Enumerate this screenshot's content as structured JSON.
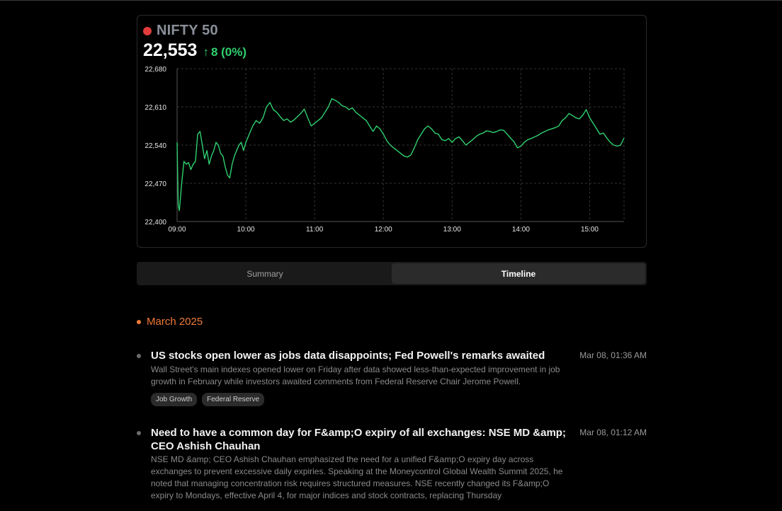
{
  "header": {
    "index_name": "NIFTY 50",
    "price": "22,553",
    "change_arrow": "↑",
    "change": "8 (0%)",
    "colors": {
      "live_dot": "#e23b3b",
      "up": "#2fd06f",
      "line": "#2fd06f"
    }
  },
  "chart_data": {
    "type": "line",
    "title": "",
    "xlabel": "",
    "ylabel": "",
    "y_ticks": [
      "22,400",
      "22,470",
      "22,540",
      "22,610",
      "22,680"
    ],
    "y_tick_values": [
      22400,
      22470,
      22540,
      22610,
      22680
    ],
    "x_ticks": [
      "09:00",
      "10:00",
      "11:00",
      "12:00",
      "13:00",
      "14:00",
      "15:00"
    ],
    "ylim": [
      22400,
      22680
    ],
    "xlim": [
      "09:00",
      "15:30"
    ],
    "grid": true,
    "series": [
      {
        "values": [
          [
            "09:00",
            22545
          ],
          [
            "09:01",
            22430
          ],
          [
            "09:02",
            22420
          ],
          [
            "09:04",
            22470
          ],
          [
            "09:06",
            22510
          ],
          [
            "09:08",
            22505
          ],
          [
            "09:10",
            22508
          ],
          [
            "09:12",
            22495
          ],
          [
            "09:14",
            22505
          ],
          [
            "09:16",
            22510
          ],
          [
            "09:18",
            22560
          ],
          [
            "09:20",
            22565
          ],
          [
            "09:22",
            22540
          ],
          [
            "09:24",
            22515
          ],
          [
            "09:26",
            22530
          ],
          [
            "09:28",
            22505
          ],
          [
            "09:30",
            22520
          ],
          [
            "09:32",
            22530
          ],
          [
            "09:34",
            22545
          ],
          [
            "09:36",
            22540
          ],
          [
            "09:38",
            22525
          ],
          [
            "09:40",
            22520
          ],
          [
            "09:42",
            22500
          ],
          [
            "09:44",
            22485
          ],
          [
            "09:46",
            22480
          ],
          [
            "09:48",
            22505
          ],
          [
            "09:50",
            22520
          ],
          [
            "09:52",
            22530
          ],
          [
            "09:54",
            22540
          ],
          [
            "09:56",
            22545
          ],
          [
            "09:58",
            22530
          ],
          [
            "10:00",
            22545
          ],
          [
            "10:03",
            22560
          ],
          [
            "10:06",
            22575
          ],
          [
            "10:09",
            22585
          ],
          [
            "10:12",
            22580
          ],
          [
            "10:15",
            22590
          ],
          [
            "10:18",
            22610
          ],
          [
            "10:21",
            22618
          ],
          [
            "10:24",
            22605
          ],
          [
            "10:27",
            22600
          ],
          [
            "10:30",
            22592
          ],
          [
            "10:33",
            22585
          ],
          [
            "10:36",
            22588
          ],
          [
            "10:39",
            22582
          ],
          [
            "10:42",
            22586
          ],
          [
            "10:45",
            22592
          ],
          [
            "10:48",
            22598
          ],
          [
            "10:51",
            22606
          ],
          [
            "10:54",
            22590
          ],
          [
            "10:57",
            22575
          ],
          [
            "11:00",
            22580
          ],
          [
            "11:03",
            22585
          ],
          [
            "11:06",
            22590
          ],
          [
            "11:09",
            22600
          ],
          [
            "11:12",
            22610
          ],
          [
            "11:15",
            22625
          ],
          [
            "11:18",
            22622
          ],
          [
            "11:21",
            22618
          ],
          [
            "11:24",
            22612
          ],
          [
            "11:27",
            22610
          ],
          [
            "11:30",
            22605
          ],
          [
            "11:33",
            22608
          ],
          [
            "11:36",
            22600
          ],
          [
            "11:39",
            22595
          ],
          [
            "11:42",
            22590
          ],
          [
            "11:45",
            22585
          ],
          [
            "11:48",
            22575
          ],
          [
            "11:51",
            22565
          ],
          [
            "11:54",
            22575
          ],
          [
            "11:57",
            22570
          ],
          [
            "12:00",
            22560
          ],
          [
            "12:03",
            22548
          ],
          [
            "12:06",
            22540
          ],
          [
            "12:09",
            22535
          ],
          [
            "12:12",
            22530
          ],
          [
            "12:15",
            22525
          ],
          [
            "12:18",
            22520
          ],
          [
            "12:21",
            22518
          ],
          [
            "12:24",
            22522
          ],
          [
            "12:27",
            22535
          ],
          [
            "12:30",
            22550
          ],
          [
            "12:33",
            22560
          ],
          [
            "12:36",
            22570
          ],
          [
            "12:39",
            22575
          ],
          [
            "12:42",
            22570
          ],
          [
            "12:45",
            22562
          ],
          [
            "12:48",
            22560
          ],
          [
            "12:51",
            22550
          ],
          [
            "12:54",
            22548
          ],
          [
            "12:57",
            22552
          ],
          [
            "13:00",
            22545
          ],
          [
            "13:03",
            22552
          ],
          [
            "13:06",
            22555
          ],
          [
            "13:09",
            22548
          ],
          [
            "13:12",
            22540
          ],
          [
            "13:15",
            22545
          ],
          [
            "13:18",
            22550
          ],
          [
            "13:21",
            22556
          ],
          [
            "13:24",
            22560
          ],
          [
            "13:27",
            22562
          ],
          [
            "13:30",
            22566
          ],
          [
            "13:33",
            22565
          ],
          [
            "13:36",
            22563
          ],
          [
            "13:39",
            22565
          ],
          [
            "13:42",
            22568
          ],
          [
            "13:45",
            22567
          ],
          [
            "13:48",
            22560
          ],
          [
            "13:51",
            22553
          ],
          [
            "13:54",
            22546
          ],
          [
            "13:57",
            22535
          ],
          [
            "14:00",
            22538
          ],
          [
            "14:03",
            22545
          ],
          [
            "14:06",
            22550
          ],
          [
            "14:09",
            22552
          ],
          [
            "14:12",
            22555
          ],
          [
            "14:15",
            22558
          ],
          [
            "14:18",
            22562
          ],
          [
            "14:21",
            22565
          ],
          [
            "14:24",
            22568
          ],
          [
            "14:27",
            22570
          ],
          [
            "14:30",
            22572
          ],
          [
            "14:33",
            22575
          ],
          [
            "14:36",
            22585
          ],
          [
            "14:39",
            22590
          ],
          [
            "14:42",
            22598
          ],
          [
            "14:45",
            22594
          ],
          [
            "14:48",
            22590
          ],
          [
            "14:51",
            22588
          ],
          [
            "14:54",
            22595
          ],
          [
            "14:57",
            22605
          ],
          [
            "15:00",
            22590
          ],
          [
            "15:03",
            22580
          ],
          [
            "15:06",
            22570
          ],
          [
            "15:09",
            22560
          ],
          [
            "15:12",
            22562
          ],
          [
            "15:15",
            22553
          ],
          [
            "15:18",
            22545
          ],
          [
            "15:21",
            22540
          ],
          [
            "15:24",
            22538
          ],
          [
            "15:27",
            22540
          ],
          [
            "15:30",
            22553
          ]
        ]
      }
    ]
  },
  "tabs": [
    {
      "label": "Summary",
      "active": false
    },
    {
      "label": "Timeline",
      "active": true
    }
  ],
  "timeline": {
    "month": "March 2025",
    "items": [
      {
        "headline": "US stocks open lower as jobs data disappoints; Fed Powell's remarks awaited",
        "time": "Mar 08, 01:36 AM",
        "summary": "Wall Street's main indexes opened lower on Friday after data showed less-than-expected improvement in job growth in February while investors awaited comments from Federal Reserve Chair Jerome Powell.",
        "tags": [
          "Job Growth",
          "Federal Reserve"
        ]
      },
      {
        "headline": "Need to have a common day for F&amp;O expiry of all exchanges: NSE MD &amp; CEO Ashish Chauhan",
        "time": "Mar 08, 01:12 AM",
        "summary": "NSE MD &amp; CEO Ashish Chauhan emphasized the need for a unified F&amp;O expiry day across exchanges to prevent excessive daily expiries. Speaking at the Moneycontrol Global Wealth Summit 2025, he noted that managing concentration risk requires structured measures. NSE recently changed its F&amp;O expiry to Mondays, effective April 4, for major indices and stock contracts, replacing Thursday",
        "tags": []
      }
    ]
  }
}
